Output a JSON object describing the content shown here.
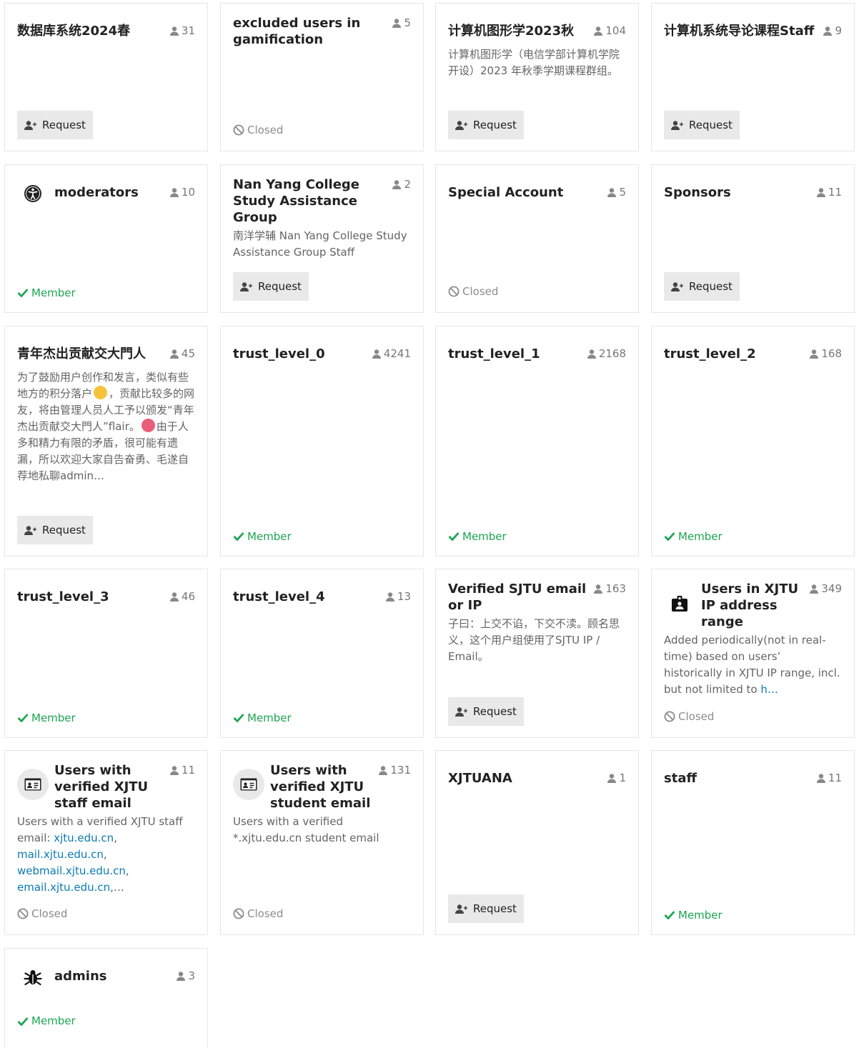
{
  "labels": {
    "request": "Request",
    "member": "Member",
    "closed": "Closed"
  },
  "colors": {
    "member_green": "#1ca551",
    "closed_gray": "#8c8c8c",
    "button_bg": "#e9e9e9",
    "link_blue": "#0a7bb3"
  },
  "groups": [
    {
      "name": "数据库系统2024春",
      "count": "31",
      "status": "Request"
    },
    {
      "name": "excluded users in gamification",
      "count": "5",
      "status": "Closed"
    },
    {
      "name": "计算机图形学2023秋",
      "count": "104",
      "description": "计算机图形学（电信学部计算机学院开设）2023 年秋季学期课程群组。",
      "status": "Request"
    },
    {
      "name": "计算机系统导论课程Staff",
      "count": "9",
      "status": "Request"
    },
    {
      "name": "moderators",
      "count": "10",
      "icon": "accessibility-icon",
      "status": "Member"
    },
    {
      "name": "Nan Yang College Study Assistance Group",
      "count": "2",
      "description": "南洋学辅 Nan Yang College Study Assistance Group Staff",
      "status": "Request"
    },
    {
      "name": "Special Account",
      "count": "5",
      "status": "Closed"
    },
    {
      "name": "Sponsors",
      "count": "11",
      "status": "Request"
    },
    {
      "name": "青年杰出贡献交大門人",
      "count": "45",
      "description_parts": [
        "为了鼓励用户创作和发言，类似有些地方的积分落户",
        "，贡献比较多的网友，将由管理人员人工予以颁发“青年杰出贡献交大門人”flair。",
        "由于人多和精力有限的矛盾，很可能有遗漏，所以欢迎大家自告奋勇、毛遂自荐地私聊admin…"
      ],
      "status": "Request"
    },
    {
      "name": "trust_level_0",
      "count": "4241",
      "status": "Member"
    },
    {
      "name": "trust_level_1",
      "count": "2168",
      "status": "Member"
    },
    {
      "name": "trust_level_2",
      "count": "168",
      "status": "Member"
    },
    {
      "name": "trust_level_3",
      "count": "46",
      "status": "Member"
    },
    {
      "name": "trust_level_4",
      "count": "13",
      "status": "Member"
    },
    {
      "name": "Verified SJTU email or IP",
      "count": "163",
      "description": "子曰：上交不谄，下交不渎。顾名思义，这个用户组使用了SJTU IP / Email。",
      "status": "Request"
    },
    {
      "name": "Users in XJTU IP address range",
      "count": "349",
      "icon": "id-badge-icon",
      "description": "Added periodically(not in real-time) based on users’ historically in XJTU IP range, incl. but not limited to ",
      "link_text": "h…",
      "status": "Closed"
    },
    {
      "name": "Users with verified XJTU staff email",
      "count": "11",
      "icon": "id-card-icon",
      "description": "Users with a verified XJTU staff email: ",
      "links": [
        "xjtu.edu.cn",
        "mail.xjtu.edu.cn",
        "webmail.xjtu.edu.cn",
        "email.xjtu.edu.cn"
      ],
      "ellipsis": ",…",
      "status": "Closed"
    },
    {
      "name": "Users with verified XJTU student email",
      "count": "131",
      "icon": "id-card-icon",
      "description": "Users with a verified *.xjtu.edu.cn student email",
      "status": "Closed"
    },
    {
      "name": "XJTUANA",
      "count": "1",
      "status": "Request"
    },
    {
      "name": "staff",
      "count": "11",
      "status": "Member"
    },
    {
      "name": "admins",
      "count": "3",
      "icon": "bug-icon",
      "status": "Member"
    }
  ]
}
